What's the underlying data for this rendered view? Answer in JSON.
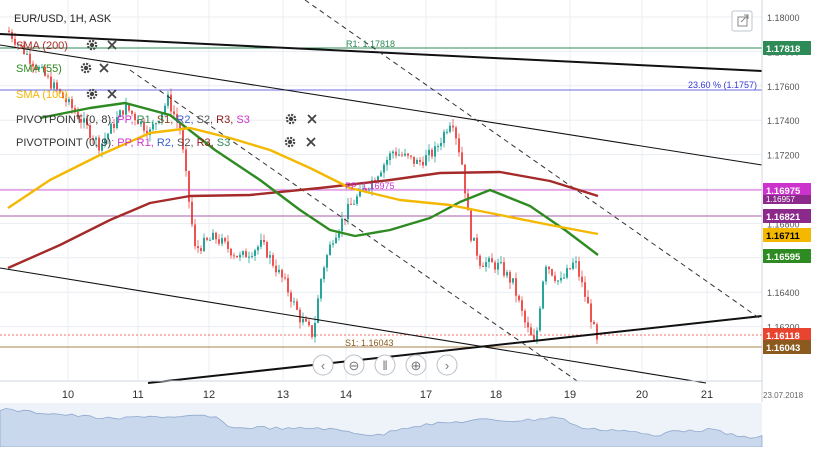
{
  "chart": {
    "symbol_label": "EUR/USD, 1H, ASK",
    "date_stamp": "23.07.2018",
    "indicators": [
      {
        "label": "SMA (200)",
        "color": "#a52a2a",
        "settings_icon": "gear-icon",
        "close_icon": "close-icon"
      },
      {
        "label": "SMA (55)",
        "color": "#2e8b22",
        "settings_icon": "gear-icon",
        "close_icon": "close-icon"
      },
      {
        "label": "SMA (100)",
        "color": "#f5b800",
        "settings_icon": "gear-icon",
        "close_icon": "close-icon"
      }
    ],
    "pivots": [
      {
        "name": "PIVOTPOINT (0, 8)",
        "levels": [
          {
            "t": ": PP,",
            "c": "#cc33cc"
          },
          {
            "t": " R1,",
            "c": "#2e8b57"
          },
          {
            "t": " S1,",
            "c": "#8b4513"
          },
          {
            "t": " R2,",
            "c": "#3a5fcd"
          },
          {
            "t": " S2,",
            "c": "#555555"
          },
          {
            "t": " R3,",
            "c": "#8b1a1a"
          },
          {
            "t": " S3",
            "c": "#cc33cc"
          }
        ]
      },
      {
        "name": "PIVOTPOINT (0, 9)",
        "levels": [
          {
            "t": ": PP,",
            "c": "#cc33cc"
          },
          {
            "t": " R1,",
            "c": "#cc33cc"
          },
          {
            "t": " R2,",
            "c": "#3a5fcd"
          },
          {
            "t": " S2,",
            "c": "#555555"
          },
          {
            "t": " R3,",
            "c": "#8b1a1a"
          },
          {
            "t": " S3",
            "c": "#2e8b57"
          }
        ]
      }
    ],
    "price_axis_ticks": [
      "1.18000",
      "1.17800",
      "1.17600",
      "1.17400",
      "1.17200",
      "1.17000",
      "1.16800",
      "1.16600",
      "1.16400",
      "1.16200"
    ],
    "date_axis_ticks": [
      "10",
      "11",
      "12",
      "13",
      "14",
      "17",
      "18",
      "19",
      "20",
      "21"
    ],
    "price_tags": [
      {
        "text": "1.17818",
        "bg": "#2e8b57",
        "fg": "#ffffff"
      },
      {
        "text": "1.16975",
        "bg": "#cc33cc",
        "fg": "#ffffff"
      },
      {
        "text": "1.16821",
        "bg": "#8b2a8b",
        "fg": "#ffffff"
      },
      {
        "text": "1.16711",
        "bg": "#f5b800",
        "fg": "#000000"
      },
      {
        "text": "1.16595",
        "bg": "#2e8b22",
        "fg": "#ffffff"
      },
      {
        "text": "1.16118",
        "bg": "#e8442f",
        "fg": "#ffffff"
      },
      {
        "text": "1.16043",
        "bg": "#8b5a1e",
        "fg": "#ffffff"
      }
    ],
    "partial_tag": "1.16957",
    "level_labels": {
      "r1": "R1: 1.17818",
      "fib": "23.60 % (1.1757)",
      "pp": "PP: 1.16975",
      "s1": "S1: 1.16043"
    },
    "nav_controls": [
      {
        "name": "scroll-left-button",
        "glyph": "‹"
      },
      {
        "name": "zoom-out-button",
        "glyph": "⊖"
      },
      {
        "name": "pause-button",
        "glyph": "‖"
      },
      {
        "name": "zoom-in-button",
        "glyph": "⊕"
      },
      {
        "name": "scroll-right-button",
        "glyph": "›"
      }
    ],
    "colors": {
      "up": "#26a69a",
      "down": "#ef5350",
      "grid": "#e9edf2",
      "axis_text": "#555555"
    }
  }
}
